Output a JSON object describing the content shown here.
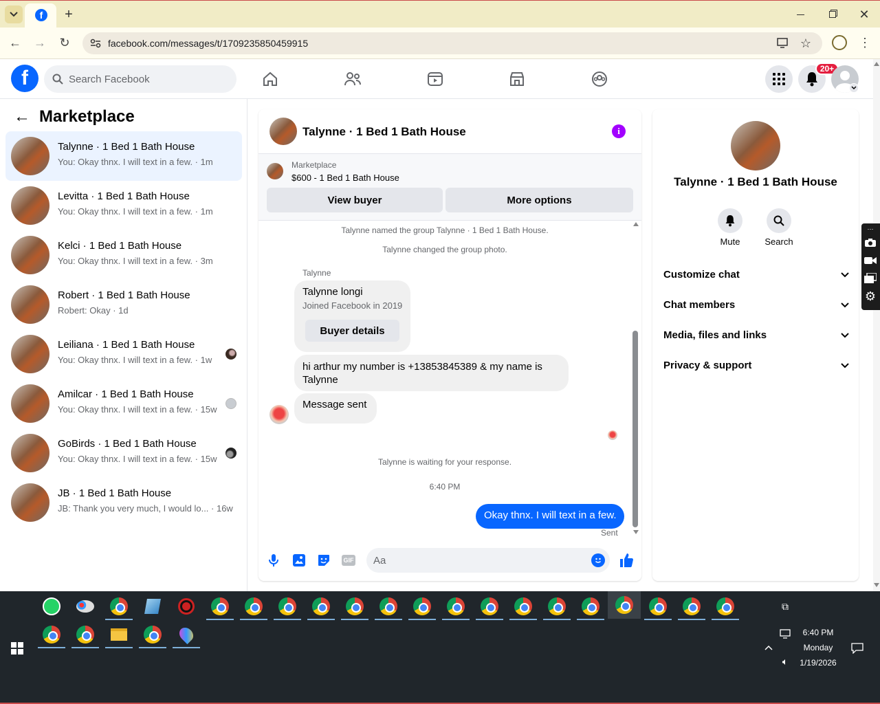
{
  "browser": {
    "tab_title": "",
    "url": "facebook.com/messages/t/1709235850459915",
    "colors": {
      "accent": "#0866ff"
    }
  },
  "header": {
    "search_placeholder": "Search Facebook",
    "notification_badge": "20+"
  },
  "left": {
    "title": "Marketplace",
    "conversations": [
      {
        "name": "Talynne · 1 Bed 1 Bath House",
        "preview": "You: Okay thnx. I will text in a few. · 1m",
        "selected": true
      },
      {
        "name": "Levitta · 1 Bed 1 Bath House",
        "preview": "You: Okay thnx. I will text in a few. · 1m"
      },
      {
        "name": "Kelci · 1 Bed 1 Bath House",
        "preview": "You: Okay thnx. I will text in a few. · 3m"
      },
      {
        "name": "Robert · 1 Bed 1 Bath House",
        "preview": "Robert: Okay · 1d"
      },
      {
        "name": "Leiliana · 1 Bed 1 Bath House",
        "preview": "You: Okay thnx. I will text in a few. · 1w"
      },
      {
        "name": "Amilcar · 1 Bed 1 Bath House",
        "preview": "You: Okay thnx. I will text in a few. · 15w"
      },
      {
        "name": "GoBirds · 1 Bed 1 Bath House",
        "preview": "You: Okay thnx. I will text in a few. · 15w"
      },
      {
        "name": "JB · 1 Bed 1 Bath House",
        "preview": "JB: Thank you very much, I would lo... · 16w"
      }
    ]
  },
  "chat": {
    "title": "Talynne · 1 Bed 1 Bath House",
    "listing_label": "Marketplace",
    "listing_price_title": "$600 - 1 Bed 1 Bath House",
    "view_buyer": "View buyer",
    "more_options": "More options",
    "sys1": "Talynne named the group Talynne · 1 Bed 1 Bath House.",
    "sys2": "Talynne changed the group photo.",
    "sender": "Talynne",
    "card_name": "Talynne longi",
    "card_joined": "Joined Facebook in 2019",
    "buyer_details": "Buyer details",
    "msg1": "hi arthur my number is +13853845389 & my name is Talynne",
    "msg2": "Message sent",
    "waiting": "Talynne is waiting for your response.",
    "time": "6:40 PM",
    "my_msg": "Okay thnx. I will text in a few.",
    "sent": "Sent",
    "composer_placeholder": "Aa"
  },
  "right": {
    "title": "Talynne · 1 Bed 1 Bath House",
    "mute": "Mute",
    "search": "Search",
    "sections": [
      "Customize chat",
      "Chat members",
      "Media, files and links",
      "Privacy & support"
    ]
  },
  "taskbar": {
    "time": "6:40 PM",
    "day": "Monday",
    "date": "1/19/2026"
  }
}
